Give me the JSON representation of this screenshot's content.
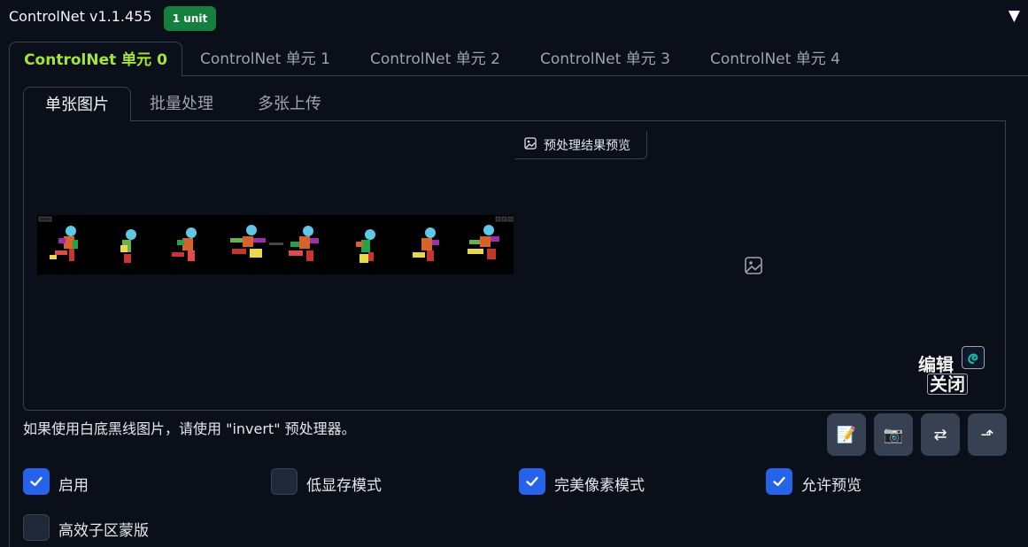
{
  "header": {
    "title": "ControlNet v1.1.455",
    "badge": "1 unit",
    "collapse_glyph": "▼"
  },
  "unit_tabs": [
    {
      "label": "ControlNet 单元 0",
      "active": true
    },
    {
      "label": "ControlNet 单元 1",
      "active": false
    },
    {
      "label": "ControlNet 单元 2",
      "active": false
    },
    {
      "label": "ControlNet 单元 3",
      "active": false
    },
    {
      "label": "ControlNet 单元 4",
      "active": false
    }
  ],
  "input_tabs": [
    {
      "label": "单张图片",
      "active": true
    },
    {
      "label": "批量处理",
      "active": false
    },
    {
      "label": "多张上传",
      "active": false
    }
  ],
  "image_area": {
    "preview_label": "预处理结果预览",
    "placeholder_icon": "image-icon",
    "watermark_top": "编辑",
    "watermark_bottom": "关闭"
  },
  "hint": "如果使用白底黑线图片，请使用 \"invert\" 预处理器。",
  "tool_buttons": [
    {
      "name": "edit-icon",
      "glyph": "📝"
    },
    {
      "name": "camera-icon",
      "glyph": "📷"
    },
    {
      "name": "swap-icon",
      "glyph": "⇄"
    },
    {
      "name": "send-dimensions-icon",
      "glyph": "⬏"
    }
  ],
  "checkboxes": [
    {
      "label": "启用",
      "checked": true
    },
    {
      "label": "低显存模式",
      "checked": false
    },
    {
      "label": "完美像素模式",
      "checked": true
    },
    {
      "label": "允许预览",
      "checked": true
    },
    {
      "label": "高效子区蒙版",
      "checked": false
    }
  ],
  "colors": {
    "background": "#0b0f19",
    "active_tab": "#a3e635",
    "badge": "#15803d",
    "checkbox_on": "#2563eb"
  }
}
